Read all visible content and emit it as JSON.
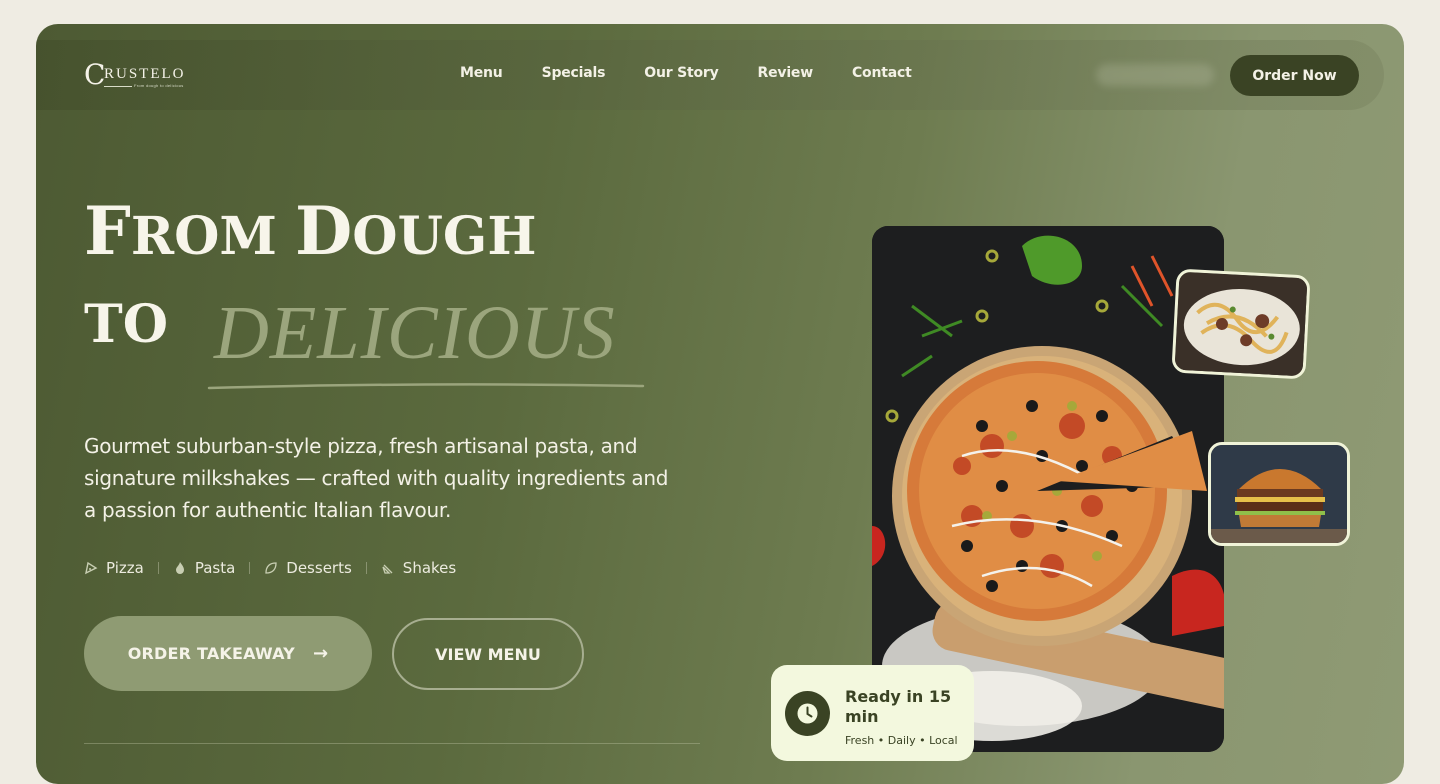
{
  "brand": {
    "name": "RUSTELO",
    "initial": "C",
    "tagline": "From dough to delicious"
  },
  "nav": {
    "links": [
      "Menu",
      "Specials",
      "Our Story",
      "Review",
      "Contact"
    ],
    "cta": "Order Now"
  },
  "hero": {
    "title_line1_a": "F",
    "title_line1_b": "ROM ",
    "title_line1_c": "D",
    "title_line1_d": "OUGH",
    "title_line2": "TO",
    "title_accent": "DELICIOUS",
    "description": "Gourmet suburban-style pizza, fresh artisanal pasta, and signature milkshakes — crafted with quality ingredients and a passion for authentic Italian flavour.",
    "categories": [
      {
        "label": "Pizza",
        "icon": "pizza-slice-icon"
      },
      {
        "label": "Pasta",
        "icon": "flame-icon"
      },
      {
        "label": "Desserts",
        "icon": "leaf-icon"
      },
      {
        "label": "Shakes",
        "icon": "cup-icon"
      }
    ],
    "primary_button": "ORDER TAKEAWAY",
    "primary_arrow": "→",
    "secondary_button": "VIEW MENU"
  },
  "ready_card": {
    "title": "Ready in 15 min",
    "subtitle": "Fresh • Daily • Local"
  },
  "colors": {
    "olive_dark": "#3a4324",
    "olive_mid": "#5b6a3e",
    "sage": "#8f9b73",
    "cream": "#f3f8de",
    "accent_text": "#9ba57d"
  }
}
